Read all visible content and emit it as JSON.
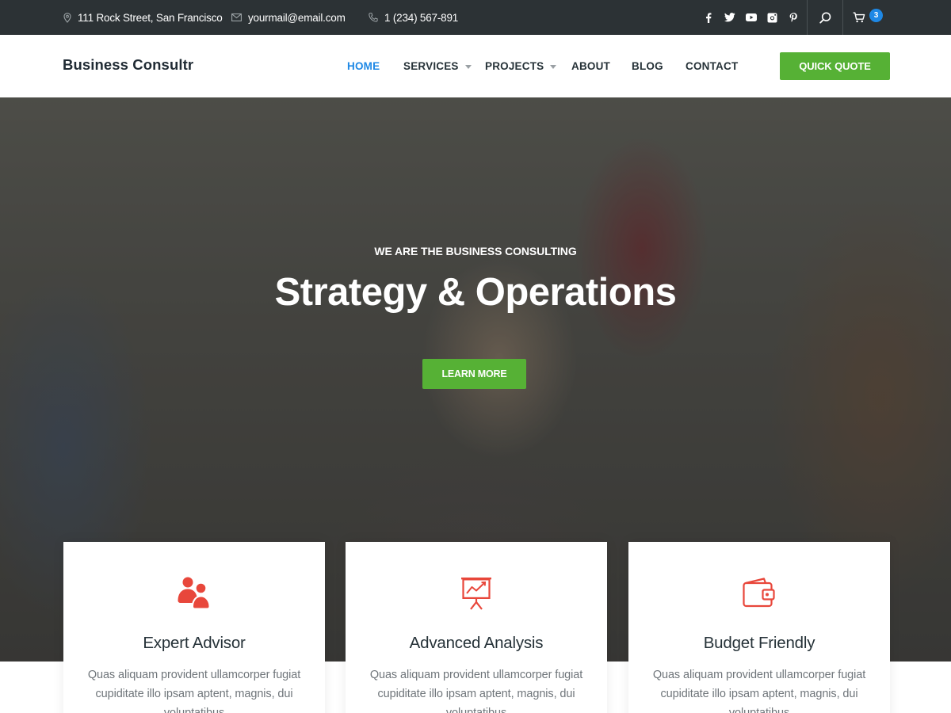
{
  "topbar": {
    "address": "111 Rock Street, San Francisco",
    "email": "yourmail@email.com",
    "phone": "1 (234) 567-891",
    "social_icons": [
      "facebook-icon",
      "twitter-icon",
      "youtube-icon",
      "instagram-icon",
      "pinterest-icon"
    ],
    "cart_count": "3"
  },
  "header": {
    "logo": "Business Consultr",
    "nav": [
      "HOME",
      "SERVICES",
      "PROJECTS",
      "ABOUT",
      "BLOG",
      "CONTACT"
    ],
    "active_nav": "HOME",
    "quote_button": "QUICK QUOTE"
  },
  "hero": {
    "subtitle": "WE ARE THE BUSINESS CONSULTING",
    "title": "Strategy & Operations",
    "button": "LEARN MORE"
  },
  "features": [
    {
      "icon": "users-icon",
      "title": "Expert Advisor",
      "text": "Quas aliquam provident ullamcorper fugiat cupiditate illo ipsam aptent, magnis, dui voluptatibus"
    },
    {
      "icon": "presentation-chart-icon",
      "title": "Advanced Analysis",
      "text": "Quas aliquam provident ullamcorper fugiat cupiditate illo ipsam aptent, magnis, dui voluptatibus"
    },
    {
      "icon": "wallet-icon",
      "title": "Budget Friendly",
      "text": "Quas aliquam provident ullamcorper fugiat cupiditate illo ipsam aptent, magnis, dui voluptatibus"
    }
  ],
  "colors": {
    "topbar_bg": "#2c3235",
    "accent_green": "#56b135",
    "accent_blue": "#1e88e5",
    "icon_red": "#e8473b"
  }
}
